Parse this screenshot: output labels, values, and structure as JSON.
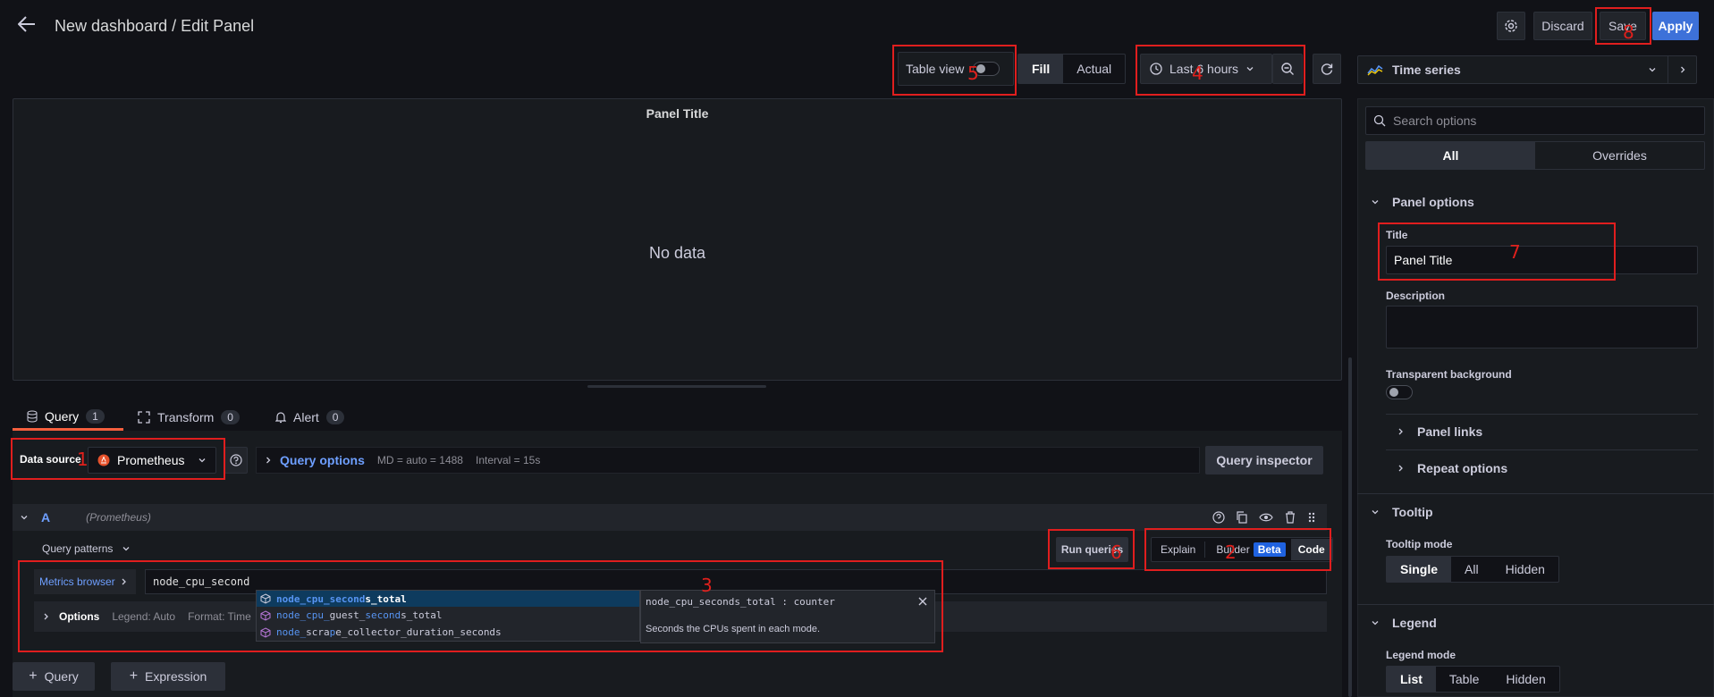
{
  "header": {
    "title": "New dashboard / Edit Panel",
    "discard_label": "Discard",
    "save_label": "Save",
    "apply_label": "Apply"
  },
  "toolbar": {
    "table_view_label": "Table view",
    "fill_label": "Fill",
    "actual_label": "Actual",
    "time_range_label": "Last 6 hours"
  },
  "panel": {
    "title": "Panel Title",
    "empty_text": "No data"
  },
  "tabs": [
    {
      "label": "Query",
      "count": "1"
    },
    {
      "label": "Transform",
      "count": "0"
    },
    {
      "label": "Alert",
      "count": "0"
    }
  ],
  "datasource": {
    "label": "Data source",
    "value": "Prometheus",
    "query_options_label": "Query options",
    "md_text": "MD = auto = 1488",
    "interval_text": "Interval = 15s",
    "inspector_label": "Query inspector"
  },
  "query_row": {
    "ref": "A",
    "source": "(Prometheus)",
    "patterns_label": "Query patterns",
    "run_label": "Run queries",
    "explain_label": "Explain",
    "builder_label": "Builder",
    "beta_label": "Beta",
    "code_label": "Code",
    "metrics_browser_label": "Metrics browser",
    "query_text": "node_cpu_second",
    "options_label": "Options",
    "legend_text": "Legend: Auto",
    "format_text": "Format: Time"
  },
  "suggestions": [
    {
      "pre": "",
      "hl1": "node_cpu_second",
      "mid": "s_total",
      "hl2": "",
      "post": ""
    },
    {
      "pre": "",
      "hl1": "node_cpu_",
      "mid": "guest_",
      "hl2": "second",
      "post": "s_total"
    },
    {
      "pre": "",
      "hl1": "node_",
      "mid": "scra",
      "hl2": "p",
      "post": "e_collector_duration_seconds"
    }
  ],
  "suggestion_detail": {
    "signature": "node_cpu_seconds_total : counter",
    "description": "Seconds the CPUs spent in each mode."
  },
  "add": {
    "query_label": "Query",
    "expression_label": "Expression"
  },
  "options": {
    "viz_label": "Time series",
    "search_placeholder": "Search options",
    "all_label": "All",
    "overrides_label": "Overrides",
    "panel_options_label": "Panel options",
    "title_label": "Title",
    "title_value": "Panel Title",
    "description_label": "Description",
    "transparent_label": "Transparent background",
    "panel_links_label": "Panel links",
    "repeat_label": "Repeat options",
    "tooltip_label": "Tooltip",
    "tooltip_mode_label": "Tooltip mode",
    "tooltip_modes": [
      "Single",
      "All",
      "Hidden"
    ],
    "legend_label": "Legend",
    "legend_mode_label": "Legend mode",
    "legend_modes": [
      "List",
      "Table",
      "Hidden"
    ]
  },
  "annotations": [
    "1",
    "2",
    "3",
    "4",
    "5",
    "6",
    "7",
    "8"
  ],
  "colors": {
    "accent": "#3d71d9",
    "highlight_red": "#e01e1e",
    "beta_badge": "#1f62e0"
  }
}
